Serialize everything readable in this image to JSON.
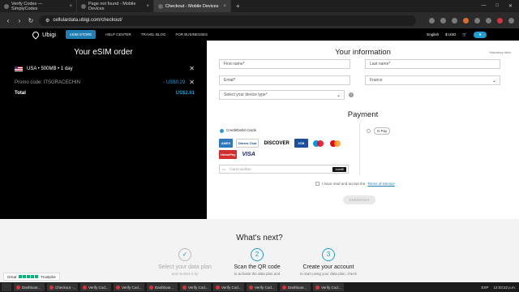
{
  "browser": {
    "tabs": [
      {
        "title": "Verify Codes — SimplyCodes",
        "active": false
      },
      {
        "title": "Page not found - Mobile Devices",
        "active": false
      },
      {
        "title": "Checkout - Mobile Devices",
        "active": true
      }
    ],
    "url": "cellulardata.ubigi.com/checkout/"
  },
  "site": {
    "logo": "Ubigi",
    "esim_store": "eSIM STORE",
    "nav": [
      "HELP CENTER",
      "TRAVEL BLOG",
      "FOR BUSINESSES"
    ],
    "language": "English",
    "currency": "$ USD"
  },
  "order": {
    "title": "Your eSIM order",
    "item": "USA • 500MB • 1 day",
    "promo_label": "Promo code: ITSGRACECHIN",
    "promo_discount": "- US$0.29",
    "total_label": "Total",
    "total_value": "US$2.61"
  },
  "info": {
    "title": "Your information",
    "required_note": "*Mandatory fields",
    "first_name_placeholder": "First name*",
    "last_name_placeholder": "Last name*",
    "email_placeholder": "Email*",
    "country_value": "France",
    "device_placeholder": "Select your device type*"
  },
  "payment": {
    "title": "Payment",
    "card_option": "Credit/Debit Cards",
    "cards": [
      "AMEX",
      "Diners Club",
      "DISCOVER",
      "JCB",
      "maestro",
      "mastercard",
      "UnionPay",
      "VISA"
    ],
    "card_placeholder": "Card number",
    "autofill_label": "Autofill",
    "gpay_label": "G Pay",
    "terms_text": "I have read and accept the",
    "terms_link": "Terms of Service",
    "checkout_label": "CHECKOUT"
  },
  "whats_next": {
    "title": "What's next?",
    "steps": [
      {
        "num": "✓",
        "title": "Select your data plan",
        "desc": "and receive it by"
      },
      {
        "num": "2",
        "title": "Scan the QR code",
        "desc": "to activate the data plan and"
      },
      {
        "num": "3",
        "title": "Create your account",
        "desc": "to start using your data plan, check"
      }
    ]
  },
  "trustpilot": {
    "label": "Great",
    "brand": "Trustpilot"
  },
  "taskbar": {
    "items": [
      "Dashboar...",
      "Checkout -...",
      "Verify Cod...",
      "Verify Cod...",
      "Dashboar...",
      "Verify Cod...",
      "Verify Cod...",
      "Verify Cod...",
      "Dashboar...",
      "Verify Cod..."
    ],
    "lang": "ESP",
    "time": "12:03:22 p.m."
  },
  "colors": {
    "accent": "#1f9ed3",
    "brand_dark": "#000000"
  }
}
